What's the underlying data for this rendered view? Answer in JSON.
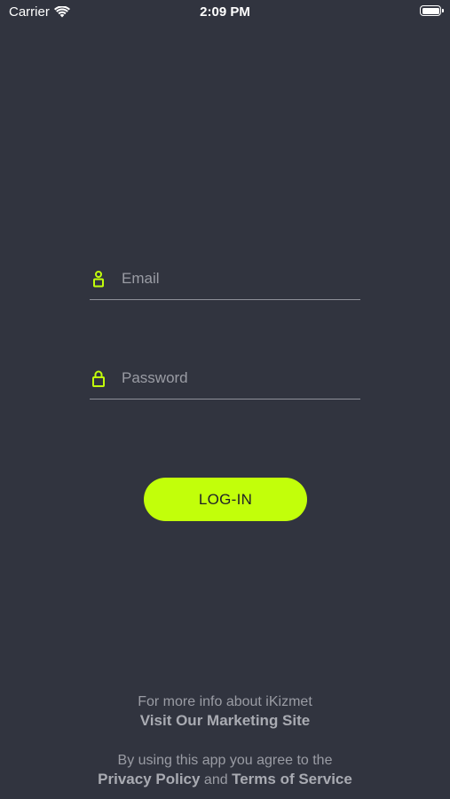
{
  "status_bar": {
    "carrier": "Carrier",
    "time": "2:09 PM",
    "battery_level": 1.0
  },
  "form": {
    "email": {
      "placeholder": "Email",
      "value": "",
      "icon": "user-icon"
    },
    "password": {
      "placeholder": "Password",
      "value": "",
      "icon": "lock-icon"
    },
    "login_label": "LOG-IN"
  },
  "footer": {
    "marketing_text": "For more info about iKizmet",
    "marketing_link": "Visit Our Marketing Site",
    "legal_text": "By using this app you agree to the",
    "privacy_link": "Privacy Policy",
    "and_text": "and",
    "terms_link": "Terms of Service"
  },
  "colors": {
    "background": "#31343F",
    "accent": "#C2FF0A",
    "underline": "#8E9099",
    "muted_text": "#9A9CA4"
  }
}
